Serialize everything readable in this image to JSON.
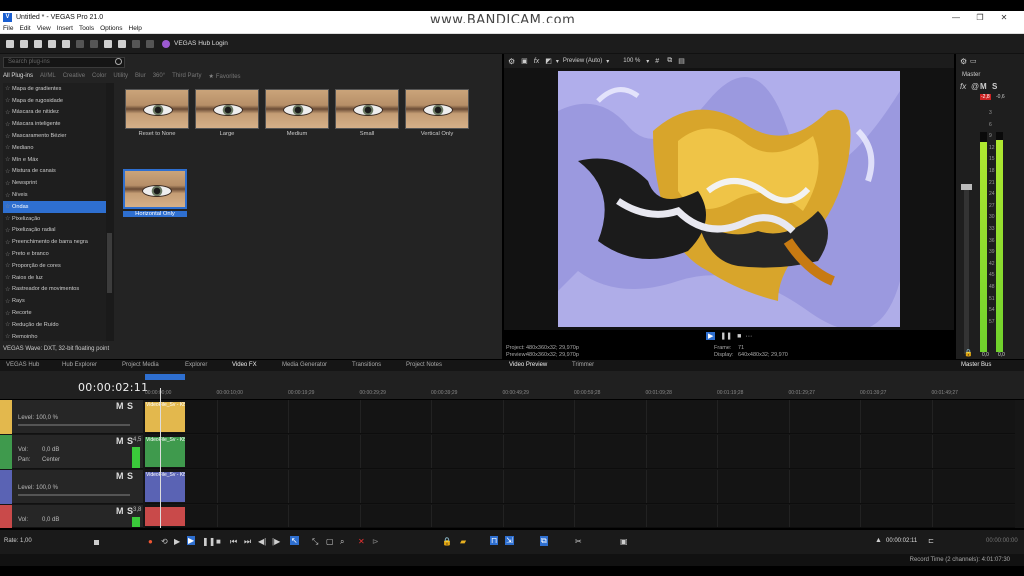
{
  "window": {
    "title": "Untitled * - VEGAS Pro 21.0",
    "watermark": "www.BANDICAM.com",
    "min": "—",
    "max": "❐",
    "close": "✕"
  },
  "menu": [
    "File",
    "Edit",
    "View",
    "Insert",
    "Tools",
    "Options",
    "Help"
  ],
  "toolbar": {
    "hub_login": "VEGAS Hub Login"
  },
  "fx_browser": {
    "search_placeholder": "Search plug-ins",
    "tabs": [
      "All Plug-ins",
      "AI/ML",
      "Creative",
      "Color",
      "Utility",
      "Blur",
      "360°",
      "Third Party",
      "Favorites"
    ],
    "items": [
      "Mapa de gradientes",
      "Mapa de rugosidade",
      "Máscara de nitidez",
      "Máscara inteligente",
      "Mascaramento Bézier",
      "Mediano",
      "Mín e Máx",
      "Mistura de canais",
      "Newsprint",
      "Níveis",
      "Ondas",
      "Pixelização",
      "Pixelização radial",
      "Preenchimento de barra negra",
      "Preto e branco",
      "Proporção de cores",
      "Raios de luz",
      "Rastreador de movimentos",
      "Rays",
      "Recorte",
      "Redução de Ruído",
      "Remoinho"
    ],
    "selected_item": "Ondas",
    "presets": [
      "Reset to None",
      "Large",
      "Medium",
      "Small",
      "Vertical Only",
      "Horizontal Only"
    ],
    "selected_preset": "Horizontal Only",
    "status": "VEGAS Wave: DXT, 32-bit floating point"
  },
  "preview": {
    "mode": "Preview (Auto)",
    "zoom": "100 %",
    "project_label": "Project:",
    "project_value": "480x360x32; 29,970p",
    "preview_label": "Preview:",
    "preview_value": "480x360x32; 29,970p",
    "frame_label": "Frame:",
    "frame_value": "71",
    "display_label": "Display:",
    "display_value": "640x480x32; 29,970"
  },
  "master": {
    "title": "Master",
    "level_left": "-2,8",
    "level_right": "-0,6",
    "scale": [
      "3",
      "6",
      "9",
      "12",
      "15",
      "18",
      "21",
      "24",
      "27",
      "30",
      "33",
      "36",
      "39",
      "42",
      "45",
      "48",
      "51",
      "54",
      "57"
    ],
    "bottom_left": "0,0",
    "bottom_right": "0,0"
  },
  "dock_tabs": [
    "VEGAS Hub",
    "Hub Explorer",
    "Project Media",
    "Explorer",
    "Video FX",
    "Media Generator",
    "Transitions",
    "Project Notes",
    "Video Preview",
    "Trimmer",
    "Master Bus"
  ],
  "timeline": {
    "timecode": "00:00:02:11",
    "ruler": [
      "00:00:00;00",
      "00:00:10;00",
      "00:00:19;29",
      "00:00:29;29",
      "00:00:39;29",
      "00:00:49;29",
      "00:00:59;28",
      "00:01:09;28",
      "00:01:19;28",
      "00:01:29;27",
      "00:01:39;27",
      "00:01:49;27"
    ],
    "tracks": [
      {
        "type": "video",
        "level_label": "Level:",
        "level": "100,0 %",
        "m": "M",
        "s": "S",
        "clip": "VideoFile_Sv - KB",
        "color": "#e3b84d"
      },
      {
        "type": "audio",
        "vol_label": "Vol:",
        "vol": "0,0 dB",
        "pan_label": "Pan:",
        "pan": "Center",
        "m": "M",
        "s": "S",
        "meter": "-4,5",
        "clip": "VideoFile_Sv - KB",
        "color": "#3f9a4d"
      },
      {
        "type": "video",
        "level_label": "Level:",
        "level": "100,0 %",
        "m": "M",
        "s": "S",
        "clip": "VideoFile_Sv - KB",
        "color": "#5a63b4"
      },
      {
        "type": "audio",
        "vol_label": "Vol:",
        "vol": "0,0 dB",
        "m": "M",
        "s": "S",
        "meter": "-3,8",
        "clip": "",
        "color": "#c94a4a"
      }
    ],
    "rate_label": "Rate:",
    "rate": "1,00",
    "end_time": "00:00:02:11",
    "end_time2": "00:00:00:00"
  },
  "status": {
    "record_time": "Record Time (2 channels): 4:01:07:30"
  }
}
